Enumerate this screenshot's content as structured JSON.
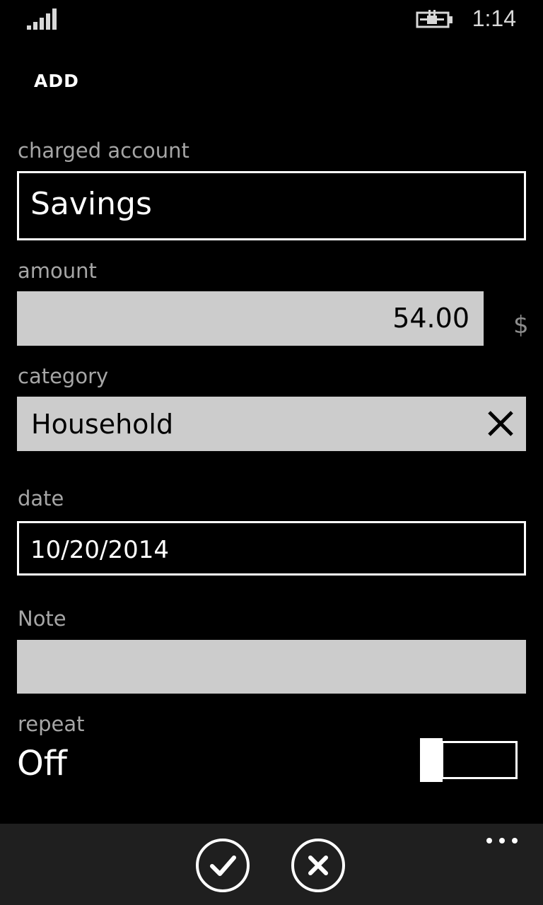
{
  "status_bar": {
    "time": "1:14",
    "signal_icon": "signal-bars-icon",
    "battery_icon": "battery-charging-icon"
  },
  "page": {
    "title": "ADD"
  },
  "form": {
    "charged_account": {
      "label": "charged account",
      "value": "Savings"
    },
    "amount": {
      "label": "amount",
      "value": "54.00",
      "currency": "$"
    },
    "category": {
      "label": "category",
      "value": "Household",
      "clear_icon": "close-icon"
    },
    "date": {
      "label": "date",
      "value": "10/20/2014"
    },
    "note": {
      "label": "Note",
      "value": ""
    },
    "repeat": {
      "label": "repeat",
      "state": "Off",
      "on": false
    }
  },
  "app_bar": {
    "save_icon": "checkmark-icon",
    "cancel_icon": "cancel-icon",
    "more_icon": "ellipsis-icon"
  },
  "colors": {
    "background": "#000000",
    "label": "#a6a6a6",
    "field_light": "#cccccc",
    "app_bar": "#1f1f1f"
  }
}
